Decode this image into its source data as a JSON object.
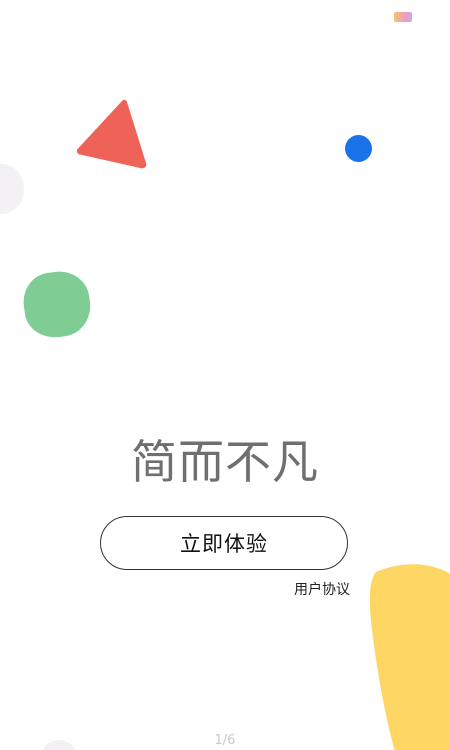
{
  "hero": {
    "tagline": "简而不凡"
  },
  "actions": {
    "start_label": "立即体验",
    "agreement_label": "用户协议"
  },
  "pager": {
    "indicator": "1/6",
    "current": 1,
    "total": 6
  },
  "decorations": {
    "triangle_color": "#ef6257",
    "blue_dot_color": "#1a73e8",
    "green_blob_color": "#7fcd95",
    "yellow_blob_color": "#fdd663",
    "gray_shape_color": "#f3f1f4"
  }
}
